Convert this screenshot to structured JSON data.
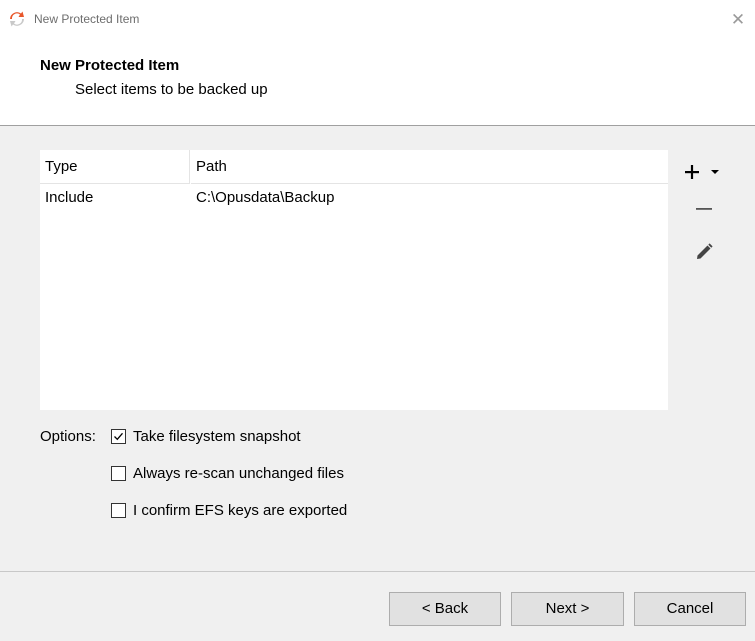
{
  "window": {
    "title": "New Protected Item",
    "close_glyph": "✕",
    "icon": "backup-app-icon"
  },
  "header": {
    "title": "New Protected Item",
    "subtitle": "Select items to be backed up"
  },
  "table": {
    "columns": [
      "Type",
      "Path"
    ],
    "rows": [
      {
        "type": "Include",
        "path": "C:\\Opusdata\\Backup"
      }
    ]
  },
  "toolbar": {
    "add_icon": "plus-icon",
    "add_menu_icon": "caret-down-icon",
    "remove_icon": "minus-icon",
    "edit_icon": "pencil-icon"
  },
  "options": {
    "label": "Options:",
    "items": [
      {
        "label": "Take filesystem snapshot",
        "checked": true
      },
      {
        "label": "Always re-scan unchanged files",
        "checked": false
      },
      {
        "label": "I confirm EFS keys are exported",
        "checked": false
      }
    ]
  },
  "footer": {
    "back_label": "< Back",
    "next_label": "Next >",
    "cancel_label": "Cancel"
  },
  "colors": {
    "accent_orange": "#e8572b",
    "header_bg": "#ffffff",
    "body_bg": "#f0f0f0",
    "button_bg": "#e1e1e1"
  }
}
